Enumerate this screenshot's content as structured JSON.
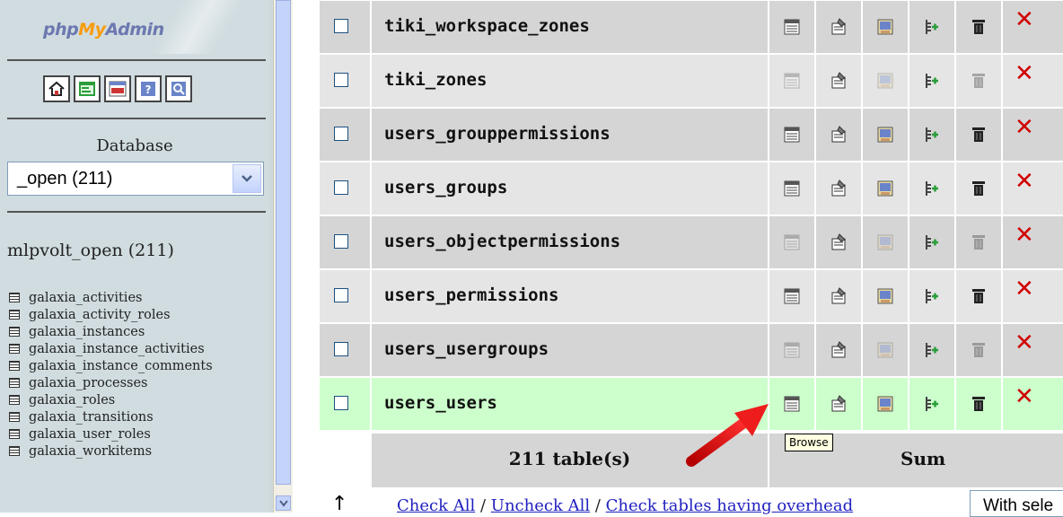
{
  "app": {
    "logo": {
      "part1": "php",
      "part2": "My",
      "part3": "Admin"
    }
  },
  "sidebar": {
    "icons": [
      "home-icon",
      "query-window-icon",
      "sql-icon",
      "docs-icon",
      "sql-docs-icon"
    ],
    "database_label": "Database",
    "database_select_value": "_open (211)",
    "database_name": "mlpvolt_open (211)",
    "tables": [
      "galaxia_activities",
      "galaxia_activity_roles",
      "galaxia_instances",
      "galaxia_instance_activities",
      "galaxia_instance_comments",
      "galaxia_processes",
      "galaxia_roles",
      "galaxia_transitions",
      "galaxia_user_roles",
      "galaxia_workitems"
    ]
  },
  "table_list": {
    "rows": [
      {
        "name": "tiki_workspace_zones",
        "empty": false,
        "bg": "#d5d5d5",
        "highlight": false
      },
      {
        "name": "tiki_zones",
        "empty": true,
        "bg": "#e5e5e5",
        "highlight": false
      },
      {
        "name": "users_grouppermissions",
        "empty": false,
        "bg": "#d5d5d5",
        "highlight": false
      },
      {
        "name": "users_groups",
        "empty": false,
        "bg": "#e5e5e5",
        "highlight": false
      },
      {
        "name": "users_objectpermissions",
        "empty": true,
        "bg": "#d5d5d5",
        "highlight": false
      },
      {
        "name": "users_permissions",
        "empty": false,
        "bg": "#e5e5e5",
        "highlight": false
      },
      {
        "name": "users_usergroups",
        "empty": true,
        "bg": "#d5d5d5",
        "highlight": false
      },
      {
        "name": "users_users",
        "empty": false,
        "bg": "#ccffcc",
        "highlight": true
      }
    ],
    "action_icons": [
      "browse-icon",
      "structure-icon",
      "search-icon",
      "insert-icon",
      "empty-icon",
      "drop-icon"
    ],
    "footer": {
      "count": "211 table(s)",
      "sum": "Sum"
    },
    "tooltip": "Browse"
  },
  "bottom": {
    "check_all": "Check All",
    "uncheck_all": "Uncheck All",
    "check_overhead": "Check tables having overhead",
    "separator": "/",
    "with_selected": "With sele"
  },
  "colors": {
    "sidebar_bg": "#d0dce0",
    "row_dark": "#d5d5d5",
    "row_light": "#e5e5e5",
    "row_highlight": "#ccffcc",
    "drop_red": "#d00000",
    "link_blue": "#2020c0"
  }
}
